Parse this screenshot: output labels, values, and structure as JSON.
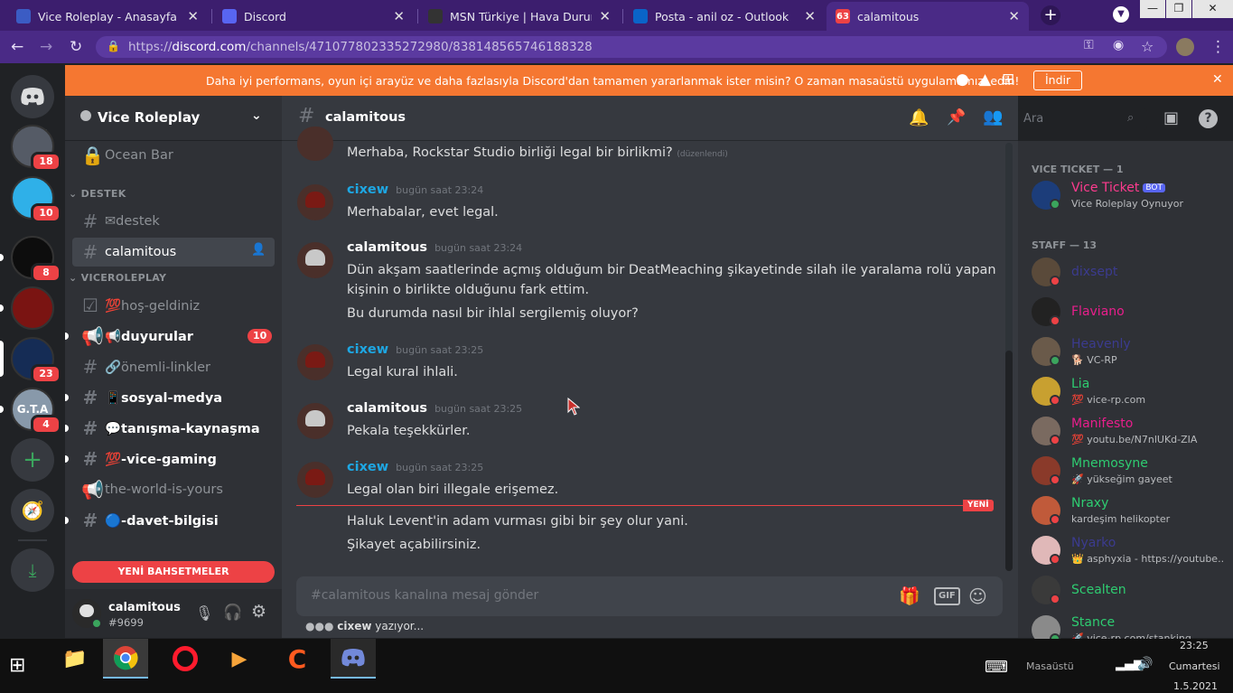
{
  "browser": {
    "tabs": [
      {
        "title": "Vice Roleplay - Anasayfa",
        "icon_color": "#3b5cc4",
        "icon": "diamond-icon"
      },
      {
        "title": "Discord",
        "icon_color": "#5865f2",
        "icon": "discord-icon"
      },
      {
        "title": "MSN Türkiye | Hava Durumu, S",
        "icon_color": "#333333",
        "icon": "msn-icon"
      },
      {
        "title": "Posta - anil oz - Outlook",
        "icon_color": "#0a64c8",
        "icon": "outlook-icon"
      },
      {
        "title": "calamitous",
        "icon_color": "#ed4245",
        "icon": "discord-badge-icon",
        "badge": "63"
      }
    ],
    "url_prefix": "https://",
    "url_domain": "discord.com",
    "url_path": "/channels/471077802335272980/838148565746188328"
  },
  "banner": {
    "text": "Daha iyi performans, oyun içi arayüz ve daha fazlasıyla Discord'dan tamamen yararlanmak ister misin? O zaman masaüstü uygulamamızı edin!",
    "button": "İndir",
    "color": "#f57731"
  },
  "guilds": [
    {
      "badge": "18",
      "color": "#555b66"
    },
    {
      "badge": "10",
      "color": "#2fb0e8"
    },
    {
      "badge": "8",
      "color": "#0d0d0d"
    },
    {
      "badge": "",
      "color": "#7a1412"
    },
    {
      "badge": "23",
      "color": "#152c55"
    },
    {
      "badge": "4",
      "color": "#8899aa",
      "label": "G.T.A"
    }
  ],
  "server": {
    "name": "Vice Roleplay",
    "top_channel": "Ocean Bar",
    "categories": [
      {
        "name": "DESTEK",
        "channels": [
          {
            "name": "✉destek",
            "state": "muted"
          },
          {
            "name": "calamitous",
            "state": "selected"
          }
        ]
      },
      {
        "name": "VICEROLEPLAY",
        "channels": [
          {
            "name": "💯hoş-geldiniz",
            "state": "muted"
          },
          {
            "name": "📢duyurular",
            "state": "unread",
            "badge": "10"
          },
          {
            "name": "🔗önemli-linkler",
            "state": "muted"
          },
          {
            "name": "📱sosyal-medya",
            "state": "unread"
          },
          {
            "name": "💬tanışma-kaynaşma",
            "state": "unread"
          },
          {
            "name": "💯-vice-gaming",
            "state": "unread"
          },
          {
            "name": "the-world-is-yours",
            "state": "muted"
          },
          {
            "name": "🔵-davet-bilgisi",
            "state": "unread"
          }
        ]
      }
    ],
    "new_mentions": "YENİ BAHSETMELER"
  },
  "user": {
    "name": "calamitous",
    "tag": "#9699"
  },
  "chat": {
    "channel": "calamitous",
    "search_placeholder": "Ara",
    "top_partial": "Merhaba,  Rockstar Studio birliği legal bir birlikmi?",
    "top_edited": "(düzenlendi)",
    "messages": [
      {
        "author": "cixew",
        "color": "#1ea7e3",
        "time": "bugün saat 23:24",
        "lines": [
          "Merhabalar, evet legal."
        ]
      },
      {
        "author": "calamitous",
        "color": "#ffffff",
        "time": "bugün saat 23:24",
        "lines": [
          "Dün akşam saatlerinde açmış olduğum bir DeatMeaching şikayetinde  silah ile yaralama rolü yapan",
          "kişinin o birlikte olduğunu fark ettim.",
          "Bu durumda nasıl bir ihlal sergilemiş oluyor?"
        ]
      },
      {
        "author": "cixew",
        "color": "#1ea7e3",
        "time": "bugün saat 23:25",
        "lines": [
          "Legal kural ihlali."
        ]
      },
      {
        "author": "calamitous",
        "color": "#ffffff",
        "time": "bugün saat 23:25",
        "lines": [
          "Pekala teşekkürler."
        ]
      },
      {
        "author": "cixew",
        "color": "#1ea7e3",
        "time": "bugün saat 23:25",
        "lines": [
          "Legal olan biri illegale erişemez."
        ]
      }
    ],
    "new_label": "YENİ",
    "after_new": [
      "Haluk Levent'in adam vurması gibi bir şey olur yani.",
      "Şikayet açabilirsiniz."
    ],
    "composer_placeholder": "#calamitous kanalına mesaj gönder",
    "typing_user": "cixew",
    "typing_suffix": " yazıyor..."
  },
  "members": {
    "groups": [
      {
        "title": "VICE TICKET — 1",
        "people": [
          {
            "name": "Vice Ticket",
            "color": "#ff3b8f",
            "bot": "BOT",
            "status": "Vice Roleplay Oynuyor",
            "presence": "online",
            "avatar": "#1c3d7a"
          }
        ]
      },
      {
        "title": "STAFF — 13",
        "people": [
          {
            "name": "dixsept",
            "color": "#3b3b8f",
            "status": "",
            "presence": "dnd",
            "avatar": "#5a4a3a"
          },
          {
            "name": "Flaviano",
            "color": "#e91e8c",
            "status": "",
            "presence": "dnd",
            "avatar": "#222222"
          },
          {
            "name": "Heavenly",
            "color": "#3b3b8f",
            "status": "🐕 VC-RP",
            "presence": "online",
            "avatar": "#6a5a4a"
          },
          {
            "name": "Lia",
            "color": "#2ecc71",
            "status": "💯 vice-rp.com",
            "presence": "dnd",
            "avatar": "#c8a030"
          },
          {
            "name": "Manifesto",
            "color": "#e91e8c",
            "status": "💯 youtu.be/N7nlUKd-ZIA",
            "presence": "dnd",
            "avatar": "#7a6a60"
          },
          {
            "name": "Mnemosyne",
            "color": "#2ecc71",
            "status": "🚀 yükseğim gayeet",
            "presence": "dnd",
            "avatar": "#8a3a2a"
          },
          {
            "name": "Nraxy",
            "color": "#2ecc71",
            "status": "kardeşim helikopter",
            "presence": "dnd",
            "avatar": "#c05a3a"
          },
          {
            "name": "Nyarko",
            "color": "#3b3b8f",
            "status": "👑 asphyxia - https://youtube....",
            "presence": "dnd",
            "avatar": "#e0b8b8"
          },
          {
            "name": "Scealten",
            "color": "#2ecc71",
            "status": "",
            "presence": "dnd",
            "avatar": "#3a3a3a"
          },
          {
            "name": "Stance",
            "color": "#2ecc71",
            "status": "🚀 vice-rp.com/stanking",
            "presence": "online",
            "avatar": "#8a8a8a"
          }
        ]
      }
    ]
  },
  "taskbar": {
    "desktop_label": "Masaüstü",
    "time": "23:25",
    "day": "Cumartesi",
    "date": "1.5.2021"
  }
}
